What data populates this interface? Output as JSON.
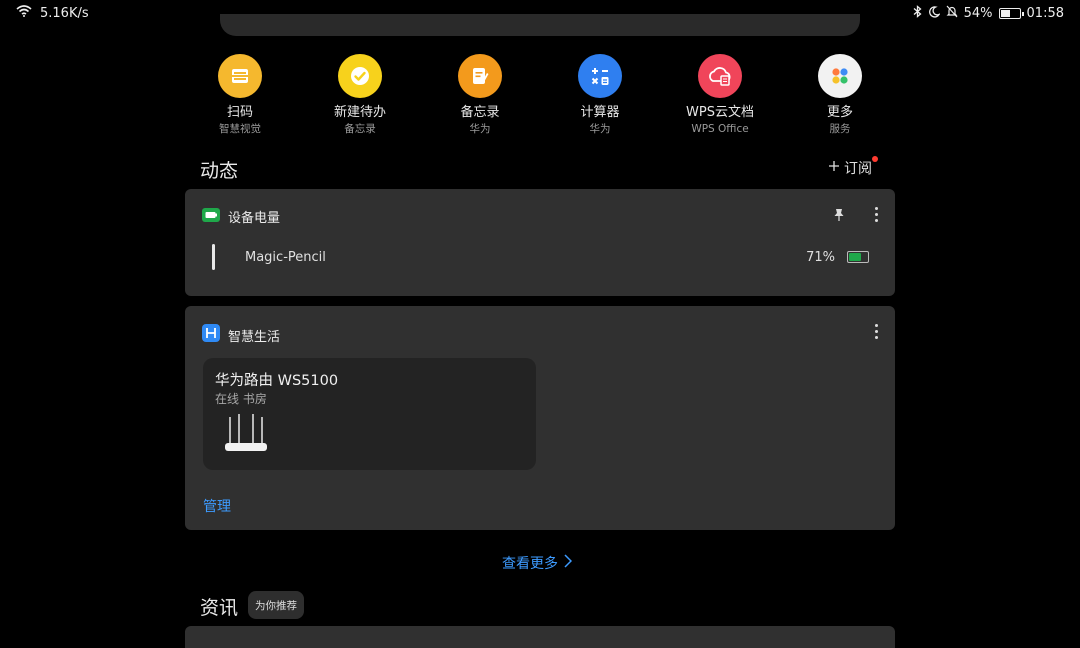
{
  "status_bar": {
    "speed": "5.16K/s",
    "battery_text": "54%",
    "battery_level": 0.54,
    "time": "01:58"
  },
  "quick_apps": [
    {
      "name": "扫码",
      "sub": "智慧视觉",
      "icon": "scan-icon",
      "color": "#f5b82e"
    },
    {
      "name": "新建待办",
      "sub": "备忘录",
      "icon": "todo-check-icon",
      "color": "#f7d21c"
    },
    {
      "name": "备忘录",
      "sub": "华为",
      "icon": "notes-icon",
      "color": "#f39a1c"
    },
    {
      "name": "计算器",
      "sub": "华为",
      "icon": "calculator-icon",
      "color": "#2f7ff0"
    },
    {
      "name": "WPS云文档",
      "sub": "WPS Office",
      "icon": "wps-cloud-icon",
      "color": "#f0455a"
    },
    {
      "name": "更多",
      "sub": "服务",
      "icon": "more-services-icon",
      "color": "#f2f2f2"
    }
  ],
  "dynamics": {
    "title": "动态",
    "subscribe": "订阅"
  },
  "battery_card": {
    "title": "设备电量",
    "device": "Magic-Pencil",
    "percent_text": "71%",
    "level": 0.71
  },
  "smart_life_card": {
    "title": "智慧生活",
    "router_name": "华为路由 WS5100",
    "router_status": "在线 书房",
    "manage": "管理"
  },
  "see_more": "查看更多",
  "news": {
    "title": "资讯",
    "badge": "为你推荐"
  },
  "colors": {
    "background": "#000000",
    "card": "#303030",
    "accent_blue": "#3d9bff",
    "battery_green": "#2bd158"
  }
}
